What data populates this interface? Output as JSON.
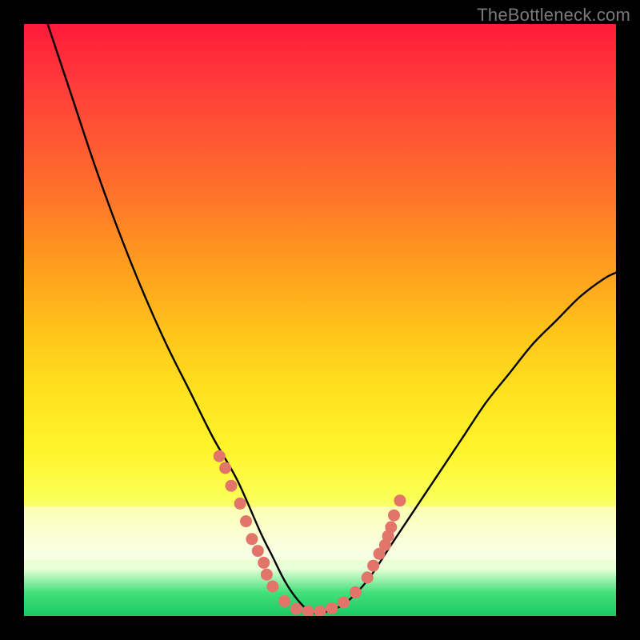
{
  "watermark": "TheBottleneck.com",
  "colors": {
    "background": "#000000",
    "curve": "#000000",
    "marker_fill": "#e2746a",
    "marker_stroke": "#d85b52",
    "gradient_top": "#ff1a3a",
    "gradient_bottom": "#18c964"
  },
  "chart_data": {
    "type": "line",
    "title": "",
    "xlabel": "",
    "ylabel": "",
    "xlim": [
      0,
      100
    ],
    "ylim": [
      0,
      100
    ],
    "grid": false,
    "note": "Axes are unlabeled in the source image; values are estimated in percent of plot area. Curve is a V-shaped bottleneck curve with scattered markers near the minimum and on the ascending branch.",
    "series": [
      {
        "name": "bottleneck-curve",
        "x": [
          4,
          8,
          12,
          16,
          20,
          24,
          28,
          32,
          36,
          40,
          42,
          44,
          46,
          48,
          50,
          54,
          58,
          62,
          66,
          70,
          74,
          78,
          82,
          86,
          90,
          94,
          98,
          100
        ],
        "y": [
          100,
          88,
          76,
          65,
          55,
          46,
          38,
          30,
          23,
          14,
          10,
          6,
          3,
          1,
          0.5,
          2,
          6,
          12,
          18,
          24,
          30,
          36,
          41,
          46,
          50,
          54,
          57,
          58
        ]
      }
    ],
    "markers": [
      {
        "x": 33,
        "y": 27
      },
      {
        "x": 34,
        "y": 25
      },
      {
        "x": 35,
        "y": 22
      },
      {
        "x": 36.5,
        "y": 19
      },
      {
        "x": 37.5,
        "y": 16
      },
      {
        "x": 38.5,
        "y": 13
      },
      {
        "x": 39.5,
        "y": 11
      },
      {
        "x": 40.5,
        "y": 9
      },
      {
        "x": 41,
        "y": 7
      },
      {
        "x": 42,
        "y": 5
      },
      {
        "x": 44,
        "y": 2.5
      },
      {
        "x": 46,
        "y": 1.2
      },
      {
        "x": 48,
        "y": 0.8
      },
      {
        "x": 50,
        "y": 0.8
      },
      {
        "x": 52,
        "y": 1.3
      },
      {
        "x": 54,
        "y": 2.3
      },
      {
        "x": 56,
        "y": 4
      },
      {
        "x": 58,
        "y": 6.5
      },
      {
        "x": 59,
        "y": 8.5
      },
      {
        "x": 60,
        "y": 10.5
      },
      {
        "x": 61,
        "y": 12
      },
      {
        "x": 61.5,
        "y": 13.5
      },
      {
        "x": 62,
        "y": 15
      },
      {
        "x": 62.5,
        "y": 17
      },
      {
        "x": 63.5,
        "y": 19.5
      }
    ]
  }
}
